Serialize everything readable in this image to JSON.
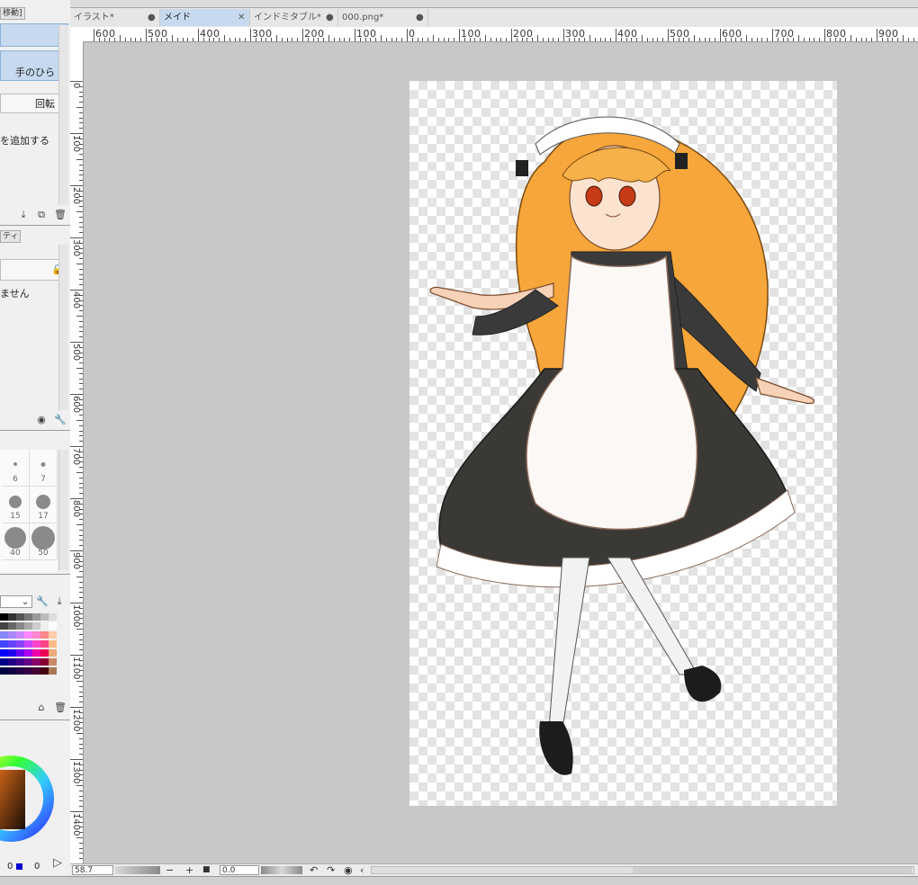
{
  "left_panel": {
    "header_tab": "移動]",
    "selected_row_label": "",
    "hand_label": "手のひら",
    "rotate_label": "回転",
    "add_label": "を追加する",
    "prop_tab": "ティ",
    "none_label": "ません",
    "brush_sizes": [
      "6",
      "7",
      "15",
      "17",
      "40",
      "50"
    ]
  },
  "color_wheel": {
    "value_left": "0",
    "value_right": "0"
  },
  "tabs": [
    {
      "label": "イラスト*",
      "active": false
    },
    {
      "label": "メイド",
      "active": true
    },
    {
      "label": "インドミタブル*",
      "active": false
    },
    {
      "label": "000.png*",
      "active": false
    }
  ],
  "ruler": {
    "h_labels": [
      "600",
      "500",
      "400",
      "300",
      "200",
      "100",
      "0",
      "100",
      "200",
      "300",
      "400",
      "500",
      "600",
      "700",
      "800",
      "900"
    ],
    "v_labels": [
      "0",
      "100",
      "200",
      "300",
      "400",
      "500",
      "600",
      "700",
      "800",
      "900",
      "1000",
      "1100",
      "1200",
      "1300",
      "1400"
    ]
  },
  "bottom_bar": {
    "zoom": "58.7",
    "angle": "0.0",
    "minus": "−",
    "plus": "+",
    "stop": "■"
  },
  "colors": {
    "accent": "#c6d9ee",
    "canvas_bg": "#c8c8c8"
  }
}
